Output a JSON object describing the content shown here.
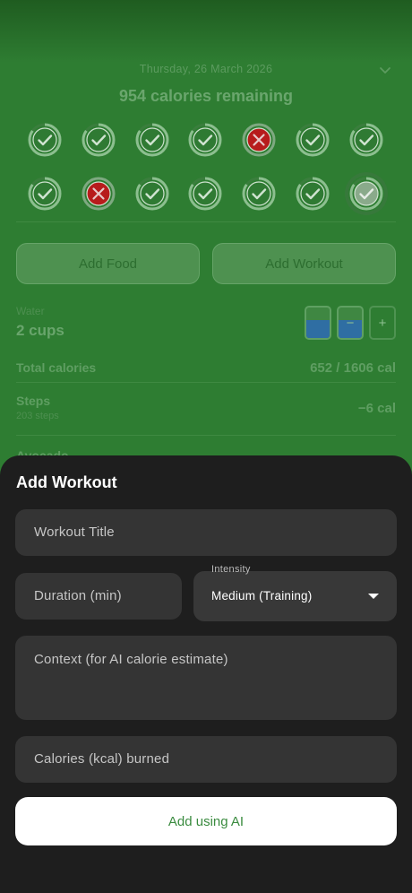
{
  "header": {
    "date": "Thursday, 26 March 2026",
    "remaining": "954 calories remaining"
  },
  "calendar": {
    "days": [
      {
        "status": "complete",
        "ring": 0.85
      },
      {
        "status": "complete",
        "ring": 0.85
      },
      {
        "status": "complete",
        "ring": 0.85
      },
      {
        "status": "complete",
        "ring": 0.85
      },
      {
        "status": "failed",
        "ring": 1
      },
      {
        "status": "complete",
        "ring": 0.85
      },
      {
        "status": "complete",
        "ring": 0.85
      },
      {
        "status": "complete",
        "ring": 0.85
      },
      {
        "status": "failed",
        "ring": 1
      },
      {
        "status": "complete",
        "ring": 0.85
      },
      {
        "status": "complete",
        "ring": 0.85
      },
      {
        "status": "complete",
        "ring": 0.85
      },
      {
        "status": "complete",
        "ring": 0.85
      },
      {
        "status": "selected",
        "ring": 0.85
      }
    ]
  },
  "actions": {
    "add_food": "Add Food",
    "add_workout": "Add Workout"
  },
  "water": {
    "label": "Water",
    "value": "2 cups",
    "cups": [
      {
        "type": "filled",
        "fill": 0.6
      },
      {
        "type": "minus",
        "fill": 0.6
      },
      {
        "type": "plus",
        "fill": 0
      }
    ],
    "minus_symbol": "−",
    "plus_symbol": "+"
  },
  "summary": {
    "total_label": "Total calories",
    "total_value": "652 / 1606 cal",
    "steps_label": "Steps",
    "steps_sub": "203 steps",
    "steps_value": "−6 cal",
    "next_item": "Avocado"
  },
  "sheet": {
    "title": "Add Workout",
    "title_placeholder": "Workout Title",
    "duration_placeholder": "Duration (min)",
    "intensity_label": "Intensity",
    "intensity_value": "Medium (Training)",
    "context_placeholder": "Context (for AI calorie estimate)",
    "calories_placeholder": "Calories (kcal) burned",
    "ai_button": "Add using AI"
  },
  "colors": {
    "background": "#2e7d32",
    "sheet": "#1e1e1e",
    "field": "#343434",
    "accent": "#3a8b3f",
    "failed": "#b71c1c"
  }
}
